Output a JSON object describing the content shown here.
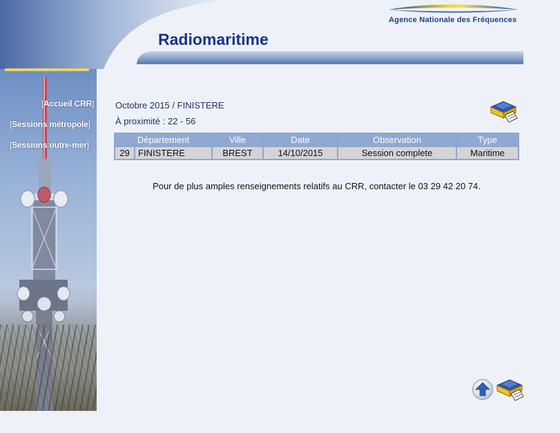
{
  "header": {
    "logo_text": "Agence Nationale des Fréquences",
    "page_title": "Radiomaritime"
  },
  "nav": {
    "items": [
      {
        "label": "Accueil CRR"
      },
      {
        "label": "Sessions métropole"
      },
      {
        "label": "Sessions outre-mer"
      }
    ]
  },
  "filter": {
    "period": "Octobre 2015",
    "separator": "/",
    "department": "FINISTERE",
    "proximity_label": "À proximité : 22 - 56"
  },
  "table": {
    "headers": [
      "Département",
      "Ville",
      "Date",
      "Observation",
      "Type"
    ],
    "rows": [
      {
        "num": "29",
        "departement": "FINISTERE",
        "ville": "BREST",
        "date": "14/10/2015",
        "observation": "Session complete",
        "type": "Maritime"
      }
    ]
  },
  "contact_text": "Pour de plus amples renseignements relatifs au CRR, contacter le 03 29 42 20 74.",
  "icons": {
    "print": "print-icon",
    "back_to_top": "arrow-up-icon"
  },
  "colors": {
    "title": "#1b3389",
    "table_header": "#8fa9d3",
    "table_cell": "#d4d4d4",
    "accent_yellow": "#e8d66a"
  }
}
